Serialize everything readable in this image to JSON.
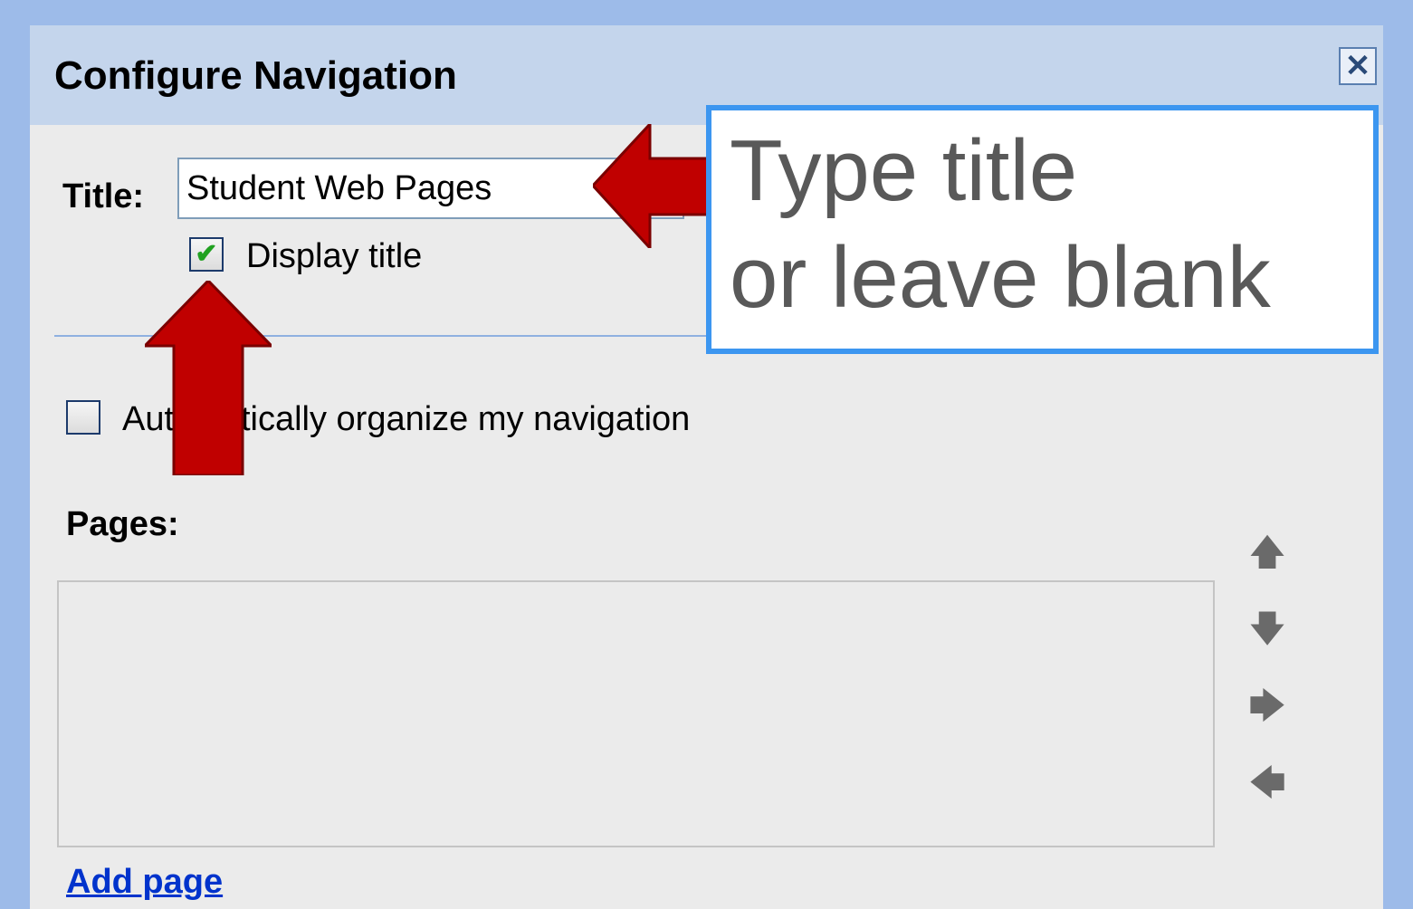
{
  "dialog": {
    "title": "Configure Navigation",
    "close_icon": "close-icon"
  },
  "form": {
    "title_label": "Title:",
    "title_value": "Student Web Pages",
    "display_title_checked": true,
    "display_title_label": "Display title",
    "auto_organize_checked": false,
    "auto_organize_label": "Automatically organize my navigation",
    "pages_label": "Pages:",
    "pages_items": [],
    "move_icons": [
      "arrow-up-icon",
      "arrow-down-icon",
      "arrow-right-icon",
      "arrow-left-icon"
    ],
    "add_page_label": "Add page"
  },
  "annotation": {
    "callout_line1": "Type title",
    "callout_line2": "or leave blank",
    "arrow_color": "#cc0000",
    "callout_border_color": "#3c96f0"
  },
  "colors": {
    "background": "#9dbbe9",
    "header": "#c4d5ec",
    "panel": "#ebebeb",
    "link": "#0033cc"
  }
}
